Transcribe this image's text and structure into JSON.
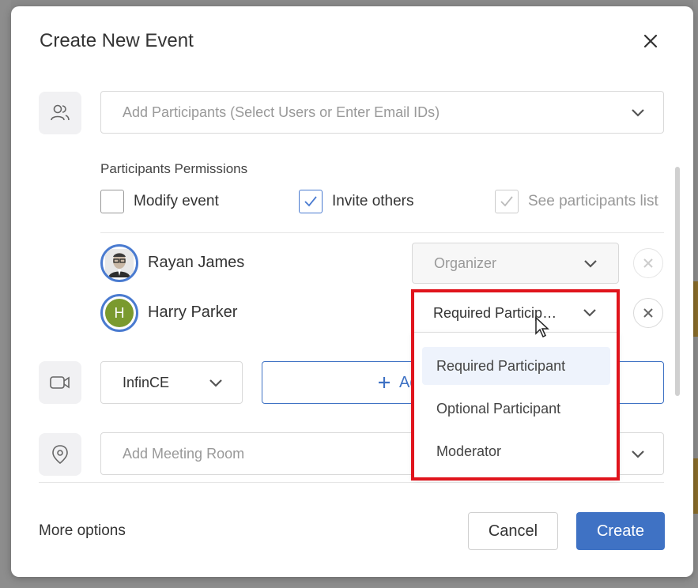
{
  "dialog": {
    "title": "Create New Event"
  },
  "participants": {
    "placeholder": "Add Participants (Select Users or Enter Email IDs)"
  },
  "permissions": {
    "title": "Participants Permissions",
    "options": [
      {
        "label": "Modify event",
        "checked": false,
        "disabled": false
      },
      {
        "label": "Invite others",
        "checked": true,
        "disabled": false
      },
      {
        "label": "See participants list",
        "checked": true,
        "disabled": true
      }
    ]
  },
  "people": [
    {
      "name": "Rayan James",
      "role": "Organizer",
      "role_disabled": true,
      "avatar": "photo"
    },
    {
      "name": "Harry Parker",
      "role": "Required Particip…",
      "role_disabled": false,
      "avatar_initial": "H",
      "avatar_color": "#7a9a2e"
    }
  ],
  "role_dropdown": {
    "options": [
      "Required Participant",
      "Optional Participant",
      "Moderator"
    ],
    "active_index": 0
  },
  "meeting": {
    "provider": "InfinCE",
    "add_label": "Ad"
  },
  "room": {
    "placeholder": "Add Meeting Room"
  },
  "footer": {
    "more_options": "More options",
    "cancel": "Cancel",
    "create": "Create"
  },
  "colors": {
    "primary": "#3f72c4",
    "highlight": "#e0141c"
  }
}
